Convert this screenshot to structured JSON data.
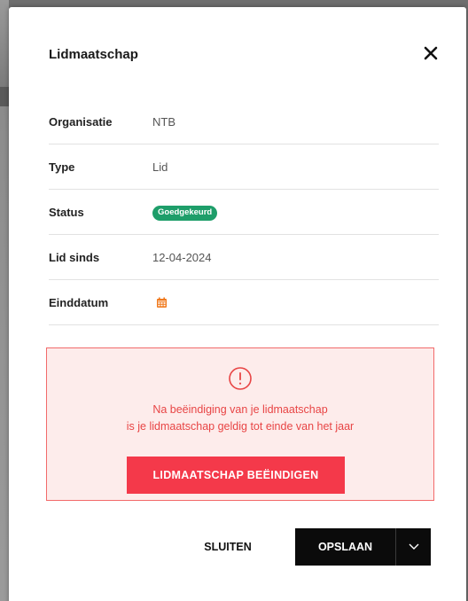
{
  "modal": {
    "title": "Lidmaatschap"
  },
  "details": {
    "rows": [
      {
        "label": "Organisatie",
        "value": "NTB"
      },
      {
        "label": "Type",
        "value": "Lid"
      },
      {
        "label": "Status",
        "value": "Goedgekeurd"
      },
      {
        "label": "Lid sinds",
        "value": "12-04-2024"
      },
      {
        "label": "Einddatum",
        "value": ""
      }
    ]
  },
  "alert": {
    "line1": "Na beëindiging van je lidmaatschap",
    "line2": "is je lidmaatschap geldig tot einde van het jaar",
    "button_label": "LIDMAATSCHAP BEËINDIGEN"
  },
  "footer": {
    "close_label": "SLUITEN",
    "save_label": "OPSLAAN"
  },
  "colors": {
    "status_badge": "#1e9e6a",
    "danger": "#f4394a",
    "alert_bg": "#fdeceb",
    "calendar_icon": "#f07a1e",
    "primary_button": "#0b0b0b"
  },
  "icons": {
    "close": "close-icon",
    "calendar": "calendar-icon",
    "alert": "exclamation-circle-icon",
    "dropdown": "chevron-down-icon"
  }
}
